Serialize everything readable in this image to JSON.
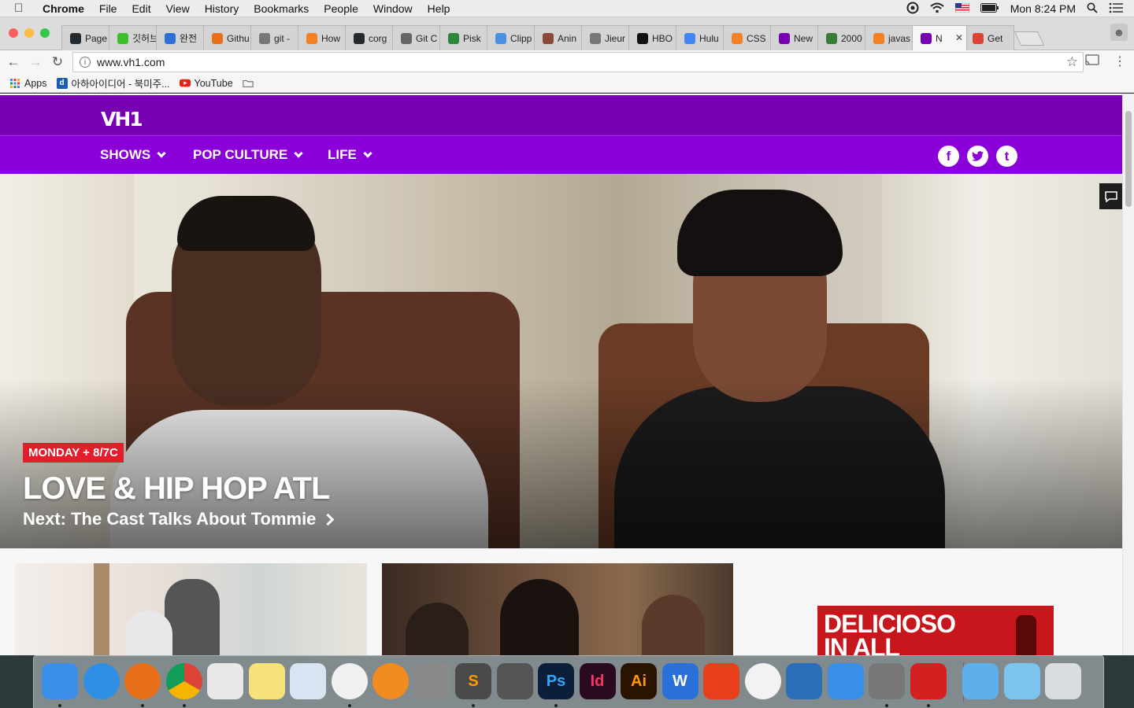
{
  "menubar": {
    "app_name": "Chrome",
    "items": [
      "File",
      "Edit",
      "View",
      "History",
      "Bookmarks",
      "People",
      "Window",
      "Help"
    ],
    "clock": "Mon 8:24 PM"
  },
  "tabs": [
    {
      "label": "Page",
      "icon": "github-icon",
      "color": "#24292e"
    },
    {
      "label": "깃허브",
      "icon": "blog-icon",
      "color": "#3bbf2a"
    },
    {
      "label": "완전",
      "icon": "circle-icon",
      "color": "#2f6fd8"
    },
    {
      "label": "Githu",
      "icon": "firefox-icon",
      "color": "#e8701a"
    },
    {
      "label": "git -",
      "icon": "page-icon",
      "color": "#777777"
    },
    {
      "label": "How",
      "icon": "stackoverflow-icon",
      "color": "#f48024"
    },
    {
      "label": "corg",
      "icon": "github-icon",
      "color": "#24292e"
    },
    {
      "label": "Git C",
      "icon": "trophy-icon",
      "color": "#666666"
    },
    {
      "label": "Pisk",
      "icon": "grid-icon",
      "color": "#2a8a3a"
    },
    {
      "label": "Clipp",
      "icon": "dots-icon",
      "color": "#4a90e2"
    },
    {
      "label": "Anin",
      "icon": "avatar-icon",
      "color": "#8a4a3a"
    },
    {
      "label": "Jieur",
      "icon": "page-icon",
      "color": "#777777"
    },
    {
      "label": "HBO",
      "icon": "hbo-icon",
      "color": "#111111"
    },
    {
      "label": "Hulu",
      "icon": "google-icon",
      "color": "#4285f4"
    },
    {
      "label": "CSS",
      "icon": "stackoverflow-icon",
      "color": "#f48024"
    },
    {
      "label": "New",
      "icon": "vh1-icon",
      "color": "#7800b2"
    },
    {
      "label": "2000",
      "icon": "globe-icon",
      "color": "#3a7a3a"
    },
    {
      "label": "javas",
      "icon": "stackoverflow-icon",
      "color": "#f48024"
    },
    {
      "label": "N",
      "icon": "vh1-icon",
      "color": "#7800b2",
      "active": true
    },
    {
      "label": "Get",
      "icon": "chrome-icon",
      "color": "#db4437"
    }
  ],
  "toolbar": {
    "url": "www.vh1.com",
    "info_icon": "i"
  },
  "bookmarks": [
    {
      "label": "Apps",
      "icon": "apps-grid-icon"
    },
    {
      "label": "아하아이디어 - 북미주...",
      "icon": "d-icon"
    },
    {
      "label": "YouTube",
      "icon": "youtube-icon"
    },
    {
      "label": "",
      "icon": "folder-icon"
    }
  ],
  "site": {
    "logo": "VH1",
    "nav": [
      {
        "label": "SHOWS"
      },
      {
        "label": "POP CULTURE"
      },
      {
        "label": "LIFE"
      }
    ],
    "social": [
      "f",
      "t",
      "t"
    ],
    "hero": {
      "badge": "MONDAY + 8/7C",
      "title": "LOVE & HIP HOP ATL",
      "subtitle": "Next: The Cast Talks About Tommie"
    },
    "ad": {
      "text": "DELICIOSO\nIN ALL"
    }
  },
  "colors": {
    "brand_purple": "#7800b2",
    "nav_purple": "#8b00d9",
    "badge_red": "#e21e2b"
  },
  "dock": [
    {
      "name": "finder-icon",
      "color": "#3b8fe8",
      "dot": true
    },
    {
      "name": "safari-icon",
      "color": "#2f8fe6",
      "dot": false
    },
    {
      "name": "firefox-icon",
      "color": "#e8701a",
      "dot": true
    },
    {
      "name": "chrome-icon",
      "color": "#ffffff",
      "dot": true
    },
    {
      "name": "launchpad-icon",
      "color": "#e8e8e8",
      "dot": false
    },
    {
      "name": "notes-icon",
      "color": "#f6e27a",
      "dot": false
    },
    {
      "name": "preview-icon",
      "color": "#d8e4f2",
      "dot": false
    },
    {
      "name": "itunes-icon",
      "color": "#f0f0f0",
      "dot": true
    },
    {
      "name": "ibooks-icon",
      "color": "#f28b1e",
      "dot": false
    },
    {
      "name": "system-preferences-icon",
      "color": "#8a8a8a",
      "dot": false
    },
    {
      "name": "sublime-text-icon",
      "color": "#4a4a4a",
      "dot": true
    },
    {
      "name": "kakao-icon",
      "color": "#555555",
      "dot": false
    },
    {
      "name": "photoshop-icon",
      "color": "#0b1e3a",
      "dot": true
    },
    {
      "name": "indesign-icon",
      "color": "#2a0a1e",
      "dot": false
    },
    {
      "name": "illustrator-icon",
      "color": "#2a1400",
      "dot": false
    },
    {
      "name": "word-icon",
      "color": "#2b6fd8",
      "dot": false
    },
    {
      "name": "polaris-icon",
      "color": "#e8401a",
      "dot": false
    },
    {
      "name": "photos-icon",
      "color": "#f2f2f2",
      "dot": false
    },
    {
      "name": "xcode-icon",
      "color": "#2a6fb8",
      "dot": false
    },
    {
      "name": "simulator-icon",
      "color": "#3a8fe8",
      "dot": false
    },
    {
      "name": "instruments-icon",
      "color": "#777777",
      "dot": true
    },
    {
      "name": "acrobat-icon",
      "color": "#d42020",
      "dot": true
    },
    {
      "name": "folder-icon",
      "color": "#5fb0ea",
      "dot": false
    },
    {
      "name": "downloads-folder-icon",
      "color": "#7cc4f0",
      "dot": false
    },
    {
      "name": "trash-icon",
      "color": "#d9dde0",
      "dot": false
    }
  ],
  "dock_labels": {
    "photoshop": "Ps",
    "indesign": "Id",
    "illustrator": "Ai",
    "word": "W",
    "sublime": "S"
  }
}
